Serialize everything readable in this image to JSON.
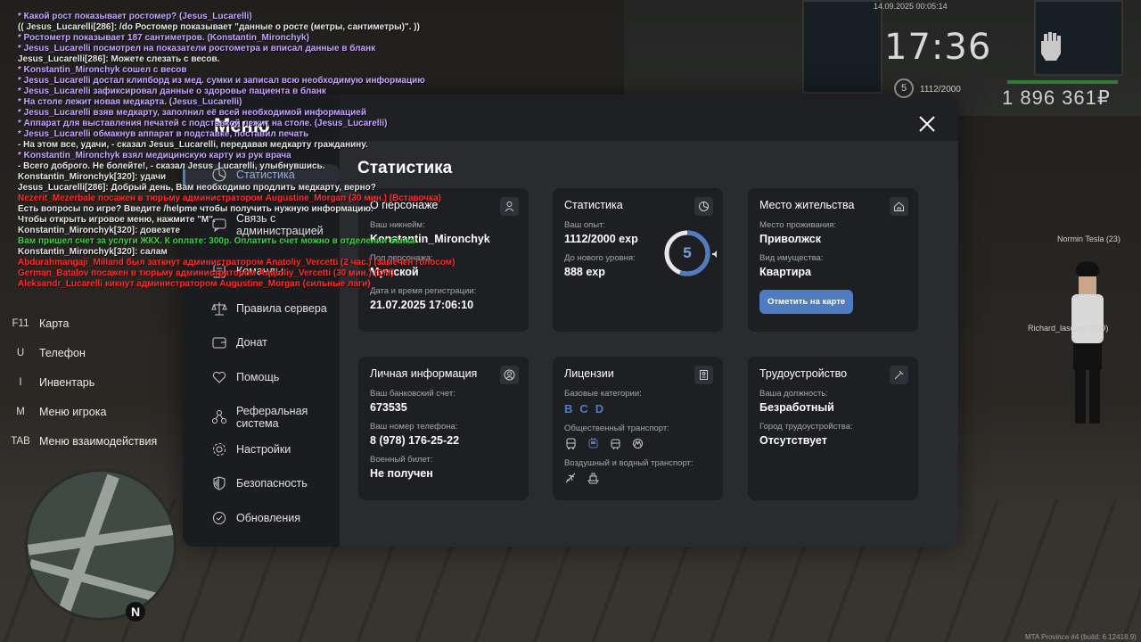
{
  "hud": {
    "datetime": "14.09.2025 00:05:14",
    "time": "17:36",
    "level": "5",
    "exp": "1112/2000",
    "money": "1 896 361₽"
  },
  "chat": [
    {
      "text": "* Какой рост показывает ростомер? (Jesus_Lucarelli)",
      "color": "#c8a6ff"
    },
    {
      "text": "(( Jesus_Lucarelli[286]: /do Ростомер показывает \"данные о росте (метры, сантиметры)\". ))",
      "color": "#e6e6e6"
    },
    {
      "text": "* Ростометр показывает 187 сантиметров. (Konstantin_Mironchyk)",
      "color": "#c8a6ff"
    },
    {
      "text": "* Jesus_Lucarelli посмотрел на показатели ростометра и вписал данные в бланк",
      "color": "#c8a6ff"
    },
    {
      "text": "Jesus_Lucarelli[286]: Можете слезать с весов.",
      "color": "#e6e6e6"
    },
    {
      "text": "* Konstantin_Mironchyk сошел с весов",
      "color": "#c8a6ff"
    },
    {
      "text": "* Jesus_Lucarelli достал клипборд из мед. сумки и записал всю необходимую информацию",
      "color": "#c8a6ff"
    },
    {
      "text": "* Jesus_Lucarelli зафиксировал данные о здоровье пациента в бланк",
      "color": "#c8a6ff"
    },
    {
      "text": "* На столе лежит новая медкарта. (Jesus_Lucarelli)",
      "color": "#c8a6ff"
    },
    {
      "text": "* Jesus_Lucarelli взяв медкарту, заполнил её всей необходимой информацией",
      "color": "#c8a6ff"
    },
    {
      "text": "* Аппарат для выставления печатей с подставкой лежит на столе. (Jesus_Lucarelli)",
      "color": "#c8a6ff"
    },
    {
      "text": "* Jesus_Lucarelli обмакнув аппарат в подставке, поставил печать",
      "color": "#c8a6ff"
    },
    {
      "text": "- На этом все, удачи, - сказал Jesus_Lucarelli, передавая медкарту гражданину.",
      "color": "#e6e6e6"
    },
    {
      "text": "* Konstantin_Mironchyk взял медицинскую карту из рук врача",
      "color": "#c8a6ff"
    },
    {
      "text": "- Всего доброго. Не болейте!, - сказал Jesus_Lucarelli, улыбнувшись.",
      "color": "#e6e6e6"
    },
    {
      "text": "Konstantin_Mironchyk[320]: удачи",
      "color": "#e6e6e6"
    },
    {
      "text": "Jesus_Lucarelli[286]: Добрый день, Вам необходимо продлить медкарту, верно?",
      "color": "#e6e6e6"
    },
    {
      "text": "Nezerit_Mezerbale посажен в тюрьму администратором Augustine_Morgan (30 мин.) (Вставочка)",
      "color": "#ff3030"
    },
    {
      "text": "Есть вопросы по игре? Введите /helpme чтобы получить нужную информацию.",
      "color": "#e6e6e6"
    },
    {
      "text": "Чтобы открыть игровое меню, нажмите \"M\".",
      "color": "#e6e6e6"
    },
    {
      "text": "Konstantin_Mironchyk[320]: довезете",
      "color": "#e6e6e6"
    },
    {
      "text": "Вам пришел счет за услуги ЖКХ. К оплате: 300р. Оплатить счет можно в отделении банка",
      "color": "#3fd24a"
    },
    {
      "text": "Konstantin_Mironchyk[320]: салам",
      "color": "#e6e6e6"
    },
    {
      "text": "Abdurahmangaji_Milland был заткнут администратором Anatoliy_Vercetti (2 час.) (замечен голосом)",
      "color": "#ff3030"
    },
    {
      "text": "German_Batalov посажен в тюрьму администратором Anatoliy_Vercetti (30 мин.) (DM)",
      "color": "#ff3030"
    },
    {
      "text": "Aleksandr_Lucarelli кикнут администратором Augustine_Morgan (сильные лаги)",
      "color": "#ff3030"
    }
  ],
  "keybinds": [
    {
      "key": "F11",
      "label": "Карта"
    },
    {
      "key": "U",
      "label": "Телефон"
    },
    {
      "key": "I",
      "label": "Инвентарь"
    },
    {
      "key": "M",
      "label": "Меню игрока"
    },
    {
      "key": "TAB",
      "label": "Меню взаимодействия"
    }
  ],
  "npcs": {
    "npc1": "Normin Tesla (23)",
    "npc2": "Richard_lascano (299)"
  },
  "footer": "MTA Province #4 (build: 6.12418.9)",
  "menu": {
    "title": "Меню",
    "items": [
      {
        "label": "Статистика",
        "icon": "stats-icon"
      },
      {
        "label": "Связь с администрацией",
        "icon": "chat-icon"
      },
      {
        "label": "Команды",
        "icon": "list-icon"
      },
      {
        "label": "Правила сервера",
        "icon": "scales-icon"
      },
      {
        "label": "Донат",
        "icon": "wallet-icon"
      },
      {
        "label": "Помощь",
        "icon": "heart-icon"
      },
      {
        "label": "Реферальная система",
        "icon": "network-icon"
      },
      {
        "label": "Настройки",
        "icon": "gear-icon"
      },
      {
        "label": "Безопасность",
        "icon": "shield-icon"
      },
      {
        "label": "Обновления",
        "icon": "update-icon"
      }
    ]
  },
  "page_title": "Статистика",
  "cards": {
    "personal": {
      "title": "О персонаже",
      "nick_label": "Ваш никнейм:",
      "nick": "Konstantin_Mironchyk",
      "sex_label": "Пол персонажа:",
      "sex": "Мужской",
      "reg_label": "Дата и время регистрации:",
      "reg": "21.07.2025 17:06:10"
    },
    "stats": {
      "title": "Статистика",
      "exp_label": "Ваш опыт:",
      "exp": "1112/2000 exp",
      "next_label": "До нового уровня:",
      "next": "888 exp",
      "level": "5",
      "level_progress": 0.556
    },
    "home": {
      "title": "Место жительства",
      "place_label": "Место проживания:",
      "place": "Приволжск",
      "type_label": "Вид имущества:",
      "type": "Квартира",
      "button": "Отметить на карте"
    },
    "private": {
      "title": "Личная информация",
      "bank_label": "Ваш банковский счет:",
      "bank": "673535",
      "phone_label": "Ваш номер телефона:",
      "phone": "8 (978) 176-25-22",
      "military_label": "Военный билет:",
      "military": "Не получен"
    },
    "licenses": {
      "title": "Лицензии",
      "base_label": "Базовые категории:",
      "base": [
        "B",
        "C",
        "D"
      ],
      "public_label": "Общественный транспорт:",
      "air_label": "Воздушный и водный транспорт:"
    },
    "job": {
      "title": "Трудоустройство",
      "pos_label": "Ваша должность:",
      "pos": "Безработный",
      "city_label": "Город трудоустройства:",
      "city": "Отсутствует"
    }
  },
  "colors": {
    "accent": "#4f7cc1",
    "chat_emote": "#c8a6ff",
    "chat_admin": "#ff3030",
    "chat_info": "#3fd24a"
  }
}
